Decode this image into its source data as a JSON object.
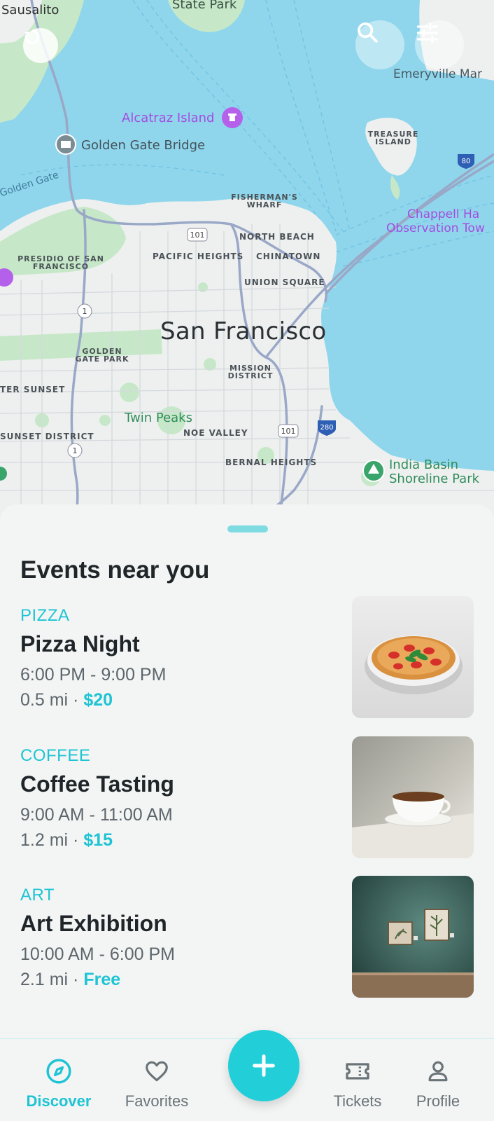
{
  "map": {
    "labels": {
      "sausalito": "Sausalito",
      "state_park": "State Park",
      "emeryville": "Emeryville Mar",
      "alcatraz": "Alcatraz Island",
      "golden_gate_bridge": "Golden Gate Bridge",
      "treasure_island": "TREASURE ISLAND",
      "golden_gate": "Golden Gate",
      "fishermans_wharf": "FISHERMAN'S WHARF",
      "chappell": "Chappell Ha",
      "observation": "Observation Tow",
      "north_beach": "NORTH BEACH",
      "presidio": "PRESIDIO OF SAN FRANCISCO",
      "pacific_heights": "PACIFIC HEIGHTS",
      "chinatown": "CHINATOWN",
      "union_square": "UNION SQUARE",
      "city": "San Francisco",
      "golden_gate_park": "GOLDEN GATE PARK",
      "mission_district": "MISSION DISTRICT",
      "outer_sunset": "TER SUNSET",
      "twin_peaks": "Twin Peaks",
      "sunset_district": "SUNSET DISTRICT",
      "noe_valley": "NOE VALLEY",
      "bernal_heights": "BERNAL HEIGHTS",
      "india_basin": "India Basin",
      "india_basin_2": "Shoreline Park",
      "hwy_101": "101",
      "hwy_1": "1",
      "hwy_80": "80",
      "hwy_280": "280"
    },
    "controls": {
      "left_icon": "refresh-icon",
      "search_icon": "search-icon",
      "filter_icon": "filter-sliders-icon"
    }
  },
  "sheet": {
    "title": "Events near you",
    "events": [
      {
        "category": "PIZZA",
        "title": "Pizza Night",
        "time": "6:00 PM - 9:00 PM",
        "distance": "0.5 mi",
        "separator": " · ",
        "price": "$20"
      },
      {
        "category": "COFFEE",
        "title": "Coffee Tasting",
        "time": "9:00 AM - 11:00 AM",
        "distance": "1.2 mi",
        "separator": " · ",
        "price": "$15"
      },
      {
        "category": "ART",
        "title": "Art Exhibition",
        "time": "10:00 AM - 6:00 PM",
        "distance": "2.1 mi",
        "separator": " · ",
        "price": "Free"
      }
    ]
  },
  "bottom_nav": {
    "items": [
      {
        "label": "Discover",
        "icon": "compass-icon",
        "active": true
      },
      {
        "label": "Favorites",
        "icon": "heart-icon",
        "active": false
      },
      {
        "label": "Tickets",
        "icon": "ticket-icon",
        "active": false
      },
      {
        "label": "Profile",
        "icon": "user-icon",
        "active": false
      }
    ],
    "fab_icon": "plus-icon"
  },
  "colors": {
    "accent": "#1ec4d4",
    "water": "#8fd6ec",
    "land": "#eef0f0",
    "park": "#bfe6c4"
  }
}
